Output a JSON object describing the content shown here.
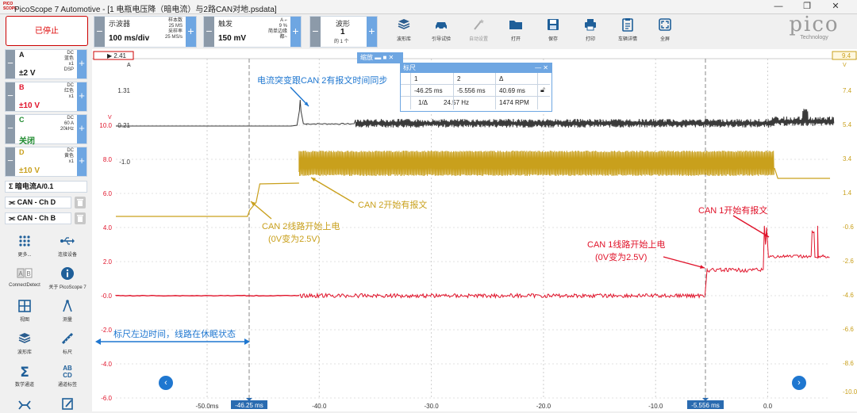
{
  "window": {
    "title": "PicoScope 7 Automotive - [1 电瓶电压降（暗电流）与2路CAN对地.psdata]",
    "app_icon_text": "PICO SCOPE"
  },
  "toolbar": {
    "status_label": "已停止",
    "scope": {
      "label": "示波器",
      "value": "100 ms/div",
      "samples_label": "样本数",
      "samples": "25 MS",
      "rate_label": "采样率",
      "rate": "25 MS/s"
    },
    "trigger": {
      "label": "触发",
      "value": "150 mV",
      "pct": "9 %",
      "mode": "简单边缘",
      "edge": "A",
      "none": "都~"
    },
    "waveform": {
      "label": "波形",
      "value": "1",
      "total": "的 1 个"
    },
    "buttons": [
      {
        "label": "波形库",
        "icon": "stack-icon",
        "enabled": true
      },
      {
        "label": "引导试验",
        "icon": "car-icon",
        "enabled": true
      },
      {
        "label": "自动设置",
        "icon": "wand-icon",
        "enabled": false
      },
      {
        "label": "打开",
        "icon": "folder-icon",
        "enabled": true
      },
      {
        "label": "保存",
        "icon": "save-icon",
        "enabled": true
      },
      {
        "label": "打印",
        "icon": "printer-icon",
        "enabled": true
      },
      {
        "label": "车辆详情",
        "icon": "clipboard-icon",
        "enabled": true
      },
      {
        "label": "全屏",
        "icon": "fullscreen-icon",
        "enabled": true
      }
    ],
    "logo_text": "pico",
    "logo_sub": "Technology"
  },
  "channels": [
    {
      "letter": "A",
      "value": "±2 V",
      "color": "#1a1a1a",
      "coupling": "DC",
      "colorname": "蓝色",
      "probe": "x1",
      "extra": "DSP"
    },
    {
      "letter": "B",
      "value": "±10 V",
      "color": "#e0132a",
      "coupling": "DC",
      "colorname": "红色",
      "probe": "x1",
      "extra": ""
    },
    {
      "letter": "C",
      "value": "关闭",
      "color": "#1e8a2e",
      "coupling": "DC",
      "colorname": "60 A",
      "probe": "20kHz",
      "extra": ""
    },
    {
      "letter": "D",
      "value": "±10 V",
      "color": "#c9a01c",
      "coupling": "DC",
      "colorname": "黄色",
      "probe": "x1",
      "extra": ""
    }
  ],
  "math_channel": "暗电流A/0.1",
  "decoders": [
    "CAN - Ch D",
    "CAN - Ch B"
  ],
  "side_buttons": [
    {
      "label": "更多...",
      "icon": "grid-dots-icon"
    },
    {
      "label": "连接设备",
      "icon": "usb-icon"
    },
    {
      "label": "ConnectDetect",
      "icon": "ab-icon"
    },
    {
      "label": "关于 PicoScope 7",
      "icon": "info-icon"
    },
    {
      "label": "视图",
      "icon": "view-grid-icon"
    },
    {
      "label": "测量",
      "icon": "compass-icon"
    },
    {
      "label": "波形库",
      "icon": "stack-icon"
    },
    {
      "label": "标尺",
      "icon": "ruler-icon"
    },
    {
      "label": "数学通道",
      "icon": "sigma-icon"
    },
    {
      "label": "通道标签",
      "icon": "abcd-icon"
    },
    {
      "label": "",
      "icon": "decode-icon"
    },
    {
      "label": "",
      "icon": "note-icon"
    }
  ],
  "scope": {
    "zoom_label": "缩放",
    "ruler_title": "标尺",
    "ruler": {
      "col1": "1",
      "col2": "2",
      "col3": "Δ",
      "v1": "-46.25 ms",
      "v2": "-5.556 ms",
      "delta": "40.69 ms",
      "inv_label": "1/Δ",
      "freq": "24.57 Hz",
      "rpm": "1474 RPM"
    },
    "left_marker": "2.41",
    "left_marker_sub": "A",
    "right_marker": "9.4",
    "right_marker_sub": "V",
    "a_scale": [
      "1.31",
      "0.21",
      "-1.0"
    ],
    "b_scale": [
      "10.0",
      "8.0",
      "6.0",
      "4.0",
      "2.0",
      "-0.0",
      "-2.0",
      "-4.0",
      "-6.0"
    ],
    "b_unit": "V",
    "right_scale": [
      "7.4",
      "5.4",
      "3.4",
      "1.4",
      "-0.6",
      "-2.6",
      "-4.6",
      "-6.6",
      "-8.6",
      "-10.0"
    ],
    "x_ticks": [
      "-50.0ms",
      "-40.0",
      "-30.0",
      "-20.0",
      "-10.0",
      "0.0"
    ],
    "cursor1_label": "-46.25 ms",
    "cursor2_label": "-5.556 ms"
  },
  "annotations": {
    "sync": "电流突变跟CAN 2有报文时间同步",
    "can2_start": "CAN 2开始有报文",
    "can2_power": "CAN 2线路开始上电",
    "can2_power_sub": "(0V变为2.5V)",
    "can1_start": "CAN 1开始有报文",
    "can1_power": "CAN 1线路开始上电",
    "can1_power_sub": "(0V变为2.5V)",
    "sleep": "标尺左边时间，线路在休眠状态"
  },
  "colors": {
    "accent": "#1f77d0",
    "chA": "#3a3a3a",
    "chB": "#e0132a",
    "chD": "#c9a01c",
    "stopped": "#d00000"
  }
}
